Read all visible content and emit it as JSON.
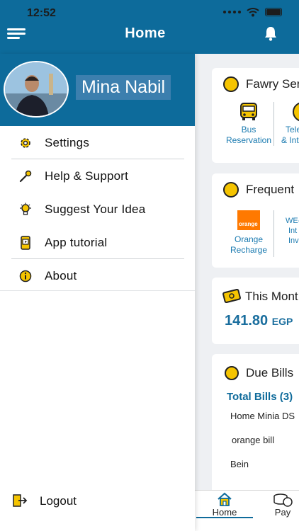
{
  "status_bar": {
    "time": "12:52"
  },
  "header": {
    "title": "Home"
  },
  "drawer": {
    "user_name": "Mina Nabil",
    "menu": [
      {
        "label": "Settings",
        "icon": "gear-icon"
      },
      {
        "label": "Help & Support",
        "icon": "wrench-icon"
      },
      {
        "label": "Suggest Your Idea",
        "icon": "lightbulb-icon"
      },
      {
        "label": "App tutorial",
        "icon": "tutorial-icon"
      },
      {
        "label": "About",
        "icon": "info-icon"
      }
    ],
    "logout_label": "Logout"
  },
  "main": {
    "services_card": {
      "title": "Fawry Ser",
      "items": [
        {
          "line1": "Bus",
          "line2": "Reservation"
        },
        {
          "line1": "Tele",
          "line2": "& Int"
        }
      ]
    },
    "frequent_card": {
      "title": "Frequent",
      "items": [
        {
          "logo_text": "orange",
          "line1": "Orange",
          "line2": "Recharge"
        },
        {
          "line1": "WE-",
          "line2": "Int",
          "line3": "Inv"
        }
      ]
    },
    "month_card": {
      "title": "This Mont",
      "amount": "141.80",
      "currency": "EGP"
    },
    "due_card": {
      "title": "Due Bills",
      "total": "Total Bills (3)",
      "bills": [
        "Home Minia DS",
        "orange bill",
        "Bein"
      ]
    }
  },
  "tabs": [
    {
      "label": "Home"
    },
    {
      "label": "Pay"
    }
  ],
  "colors": {
    "primary": "#0d6b9b",
    "accent": "#f5c400",
    "link": "#1a7ab0"
  }
}
